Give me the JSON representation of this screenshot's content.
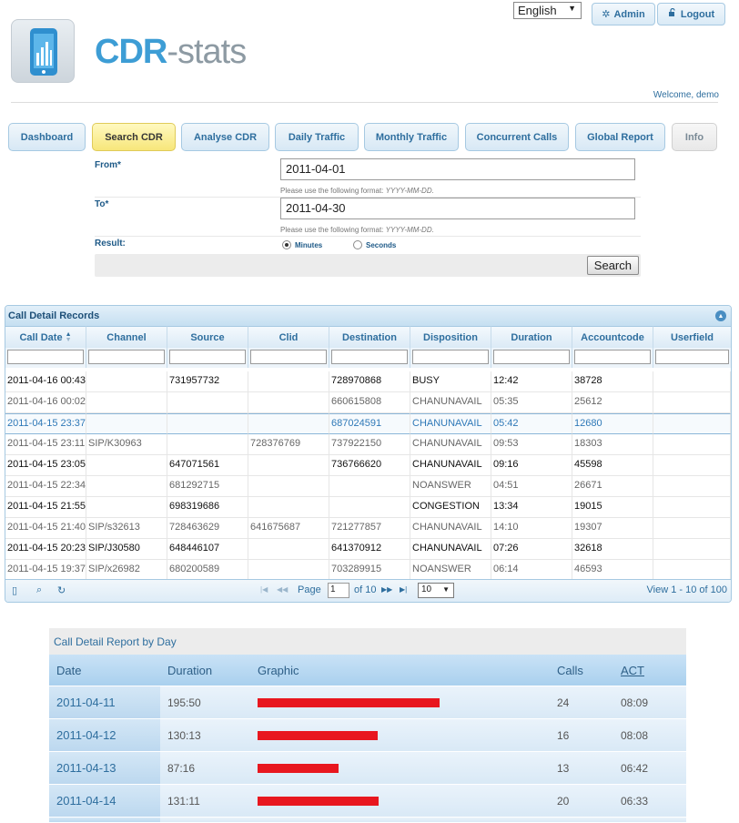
{
  "header": {
    "language": "English",
    "admin_label": "Admin",
    "logout_label": "Logout",
    "logo_primary": "CDR",
    "logo_secondary": "-stats",
    "welcome": "Welcome, demo"
  },
  "nav": {
    "tabs": [
      {
        "label": "Dashboard"
      },
      {
        "label": "Search CDR"
      },
      {
        "label": "Analyse CDR"
      },
      {
        "label": "Daily Traffic"
      },
      {
        "label": "Monthly Traffic"
      },
      {
        "label": "Concurrent Calls"
      },
      {
        "label": "Global Report"
      },
      {
        "label": "Info"
      }
    ],
    "active": "Search CDR"
  },
  "form": {
    "from_label": "From*",
    "from_value": "2011-04-01",
    "to_label": "To*",
    "to_value": "2011-04-30",
    "help_text": "Please use the following format:",
    "help_format": "YYYY-MM-DD.",
    "result_label": "Result:",
    "option_minutes": "Minutes",
    "option_seconds": "Seconds",
    "selected_option": "Minutes",
    "search_button": "Search"
  },
  "grid": {
    "caption": "Call Detail Records",
    "columns": [
      "Call Date",
      "Channel",
      "Source",
      "Clid",
      "Destination",
      "Disposition",
      "Duration",
      "Accountcode",
      "Userfield"
    ],
    "sort_column": "Call Date",
    "rows": [
      [
        "2011-04-16 00:43",
        "",
        "731957732",
        "",
        "728970868",
        "BUSY",
        "12:42",
        "38728",
        ""
      ],
      [
        "2011-04-16 00:02",
        "",
        "",
        "",
        "660615808",
        "CHANUNAVAIL",
        "05:35",
        "25612",
        ""
      ],
      [
        "2011-04-15 23:37",
        "",
        "",
        "",
        "687024591",
        "CHANUNAVAIL",
        "05:42",
        "12680",
        ""
      ],
      [
        "2011-04-15 23:11",
        "SIP/K30963",
        "",
        "728376769",
        "737922150",
        "CHANUNAVAIL",
        "09:53",
        "18303",
        ""
      ],
      [
        "2011-04-15 23:05",
        "",
        "647071561",
        "",
        "736766620",
        "CHANUNAVAIL",
        "09:16",
        "45598",
        ""
      ],
      [
        "2011-04-15 22:34",
        "",
        "681292715",
        "",
        "",
        "NOANSWER",
        "04:51",
        "26671",
        ""
      ],
      [
        "2011-04-15 21:55",
        "",
        "698319686",
        "",
        "",
        "CONGESTION",
        "13:34",
        "19015",
        ""
      ],
      [
        "2011-04-15 21:40",
        "SIP/s32613",
        "728463629",
        "641675687",
        "721277857",
        "CHANUNAVAIL",
        "14:10",
        "19307",
        ""
      ],
      [
        "2011-04-15 20:23",
        "SIP/J30580",
        "648446107",
        "",
        "641370912",
        "CHANUNAVAIL",
        "07:26",
        "32618",
        ""
      ],
      [
        "2011-04-15 19:37",
        "SIP/x26982",
        "680200589",
        "",
        "703289915",
        "NOANSWER",
        "06:14",
        "46593",
        ""
      ]
    ],
    "selected_row": 2,
    "pager": {
      "page_label": "Page",
      "page_value": "1",
      "of_label": "of 10",
      "rows_per_page": "10",
      "view_info": "View 1 - 10 of 100"
    },
    "colors": {
      "header_text": "#2e6e9e",
      "selected_text": "#2e78b7"
    }
  },
  "report": {
    "caption": "Call Detail Report by Day",
    "columns": {
      "date": "Date",
      "duration": "Duration",
      "graphic": "Graphic",
      "calls": "Calls",
      "act": "ACT"
    },
    "bar_color": "#e8171f",
    "rows": [
      {
        "date": "2011-04-11",
        "duration": "195:50",
        "calls": "24",
        "act": "08:09",
        "graphic_fraction": 1.0
      },
      {
        "date": "2011-04-12",
        "duration": "130:13",
        "calls": "16",
        "act": "08:08",
        "graphic_fraction": 0.66
      },
      {
        "date": "2011-04-13",
        "duration": "87:16",
        "calls": "13",
        "act": "06:42",
        "graphic_fraction": 0.445
      },
      {
        "date": "2011-04-14",
        "duration": "131:11",
        "calls": "20",
        "act": "06:33",
        "graphic_fraction": 0.665
      }
    ]
  }
}
